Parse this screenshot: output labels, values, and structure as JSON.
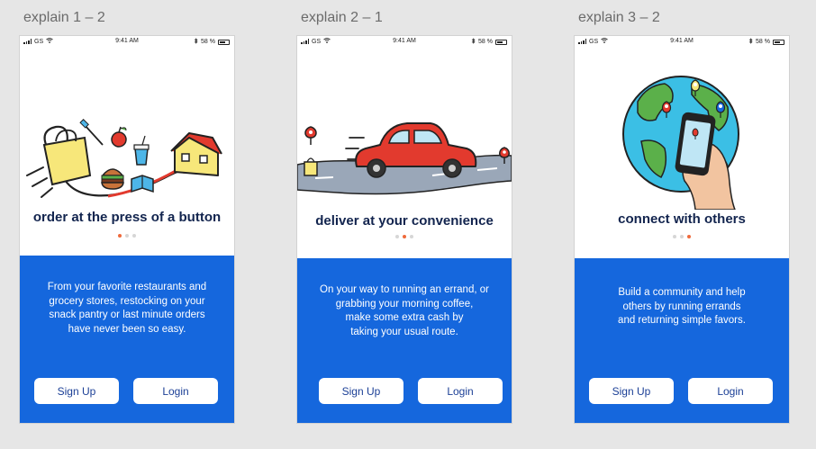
{
  "artboards": [
    {
      "label": "explain 1 – 2",
      "status": {
        "carrier": "GS",
        "time": "9:41 AM",
        "battery": "58 %"
      },
      "headline": "order at the press of a button",
      "active_dot": 0,
      "description": [
        "From your favorite restaurants and",
        "grocery stores, restocking on your",
        "snack pantry or last minute orders",
        "have never been so easy."
      ],
      "buttons": {
        "signup": "Sign Up",
        "login": "Login"
      }
    },
    {
      "label": "explain 2 – 1",
      "status": {
        "carrier": "GS",
        "time": "9:41 AM",
        "battery": "58 %"
      },
      "headline": "deliver at your convenience",
      "active_dot": 1,
      "description": [
        "On your way to running an errand, or",
        "grabbing your morning coffee,",
        "make some extra cash by",
        "taking your usual route."
      ],
      "buttons": {
        "signup": "Sign Up",
        "login": "Login"
      }
    },
    {
      "label": "explain 3 – 2",
      "status": {
        "carrier": "GS",
        "time": "9:41 AM",
        "battery": "58 %"
      },
      "headline": "connect with others",
      "active_dot": 2,
      "description": [
        "Build a community and help",
        "others by running errands",
        "and returning simple favors."
      ],
      "buttons": {
        "signup": "Sign Up",
        "login": "Login"
      }
    }
  ],
  "colors": {
    "panel_blue": "#1567dd",
    "headline_navy": "#12244e",
    "dot_active": "#ef6a3c",
    "dot_inactive": "#d6d6d6",
    "button_text": "#1b3f96",
    "canvas_bg": "#e6e6e6"
  }
}
